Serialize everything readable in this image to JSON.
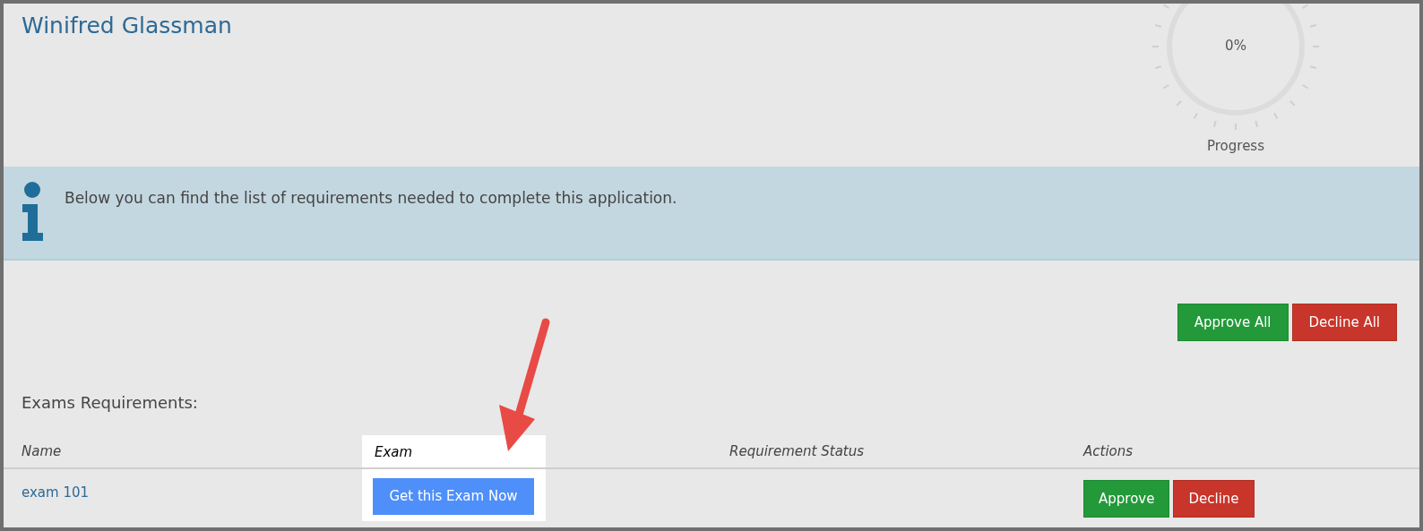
{
  "title": "Winifred Glassman",
  "progress": {
    "reading": "0%",
    "label": "Progress"
  },
  "info": {
    "text": "Below you can find the list of requirements needed to complete this application."
  },
  "bulk_actions": [
    "Approve All",
    "Decline All"
  ],
  "section_title": "Exams Requirements:",
  "table": {
    "columns": [
      "Name",
      "Exam",
      "Requirement Status",
      "Actions"
    ],
    "rows": [
      {
        "name": "exam 101",
        "exam_button": "Get this Exam Now",
        "actions": [
          "Approve",
          "Decline"
        ]
      }
    ]
  }
}
